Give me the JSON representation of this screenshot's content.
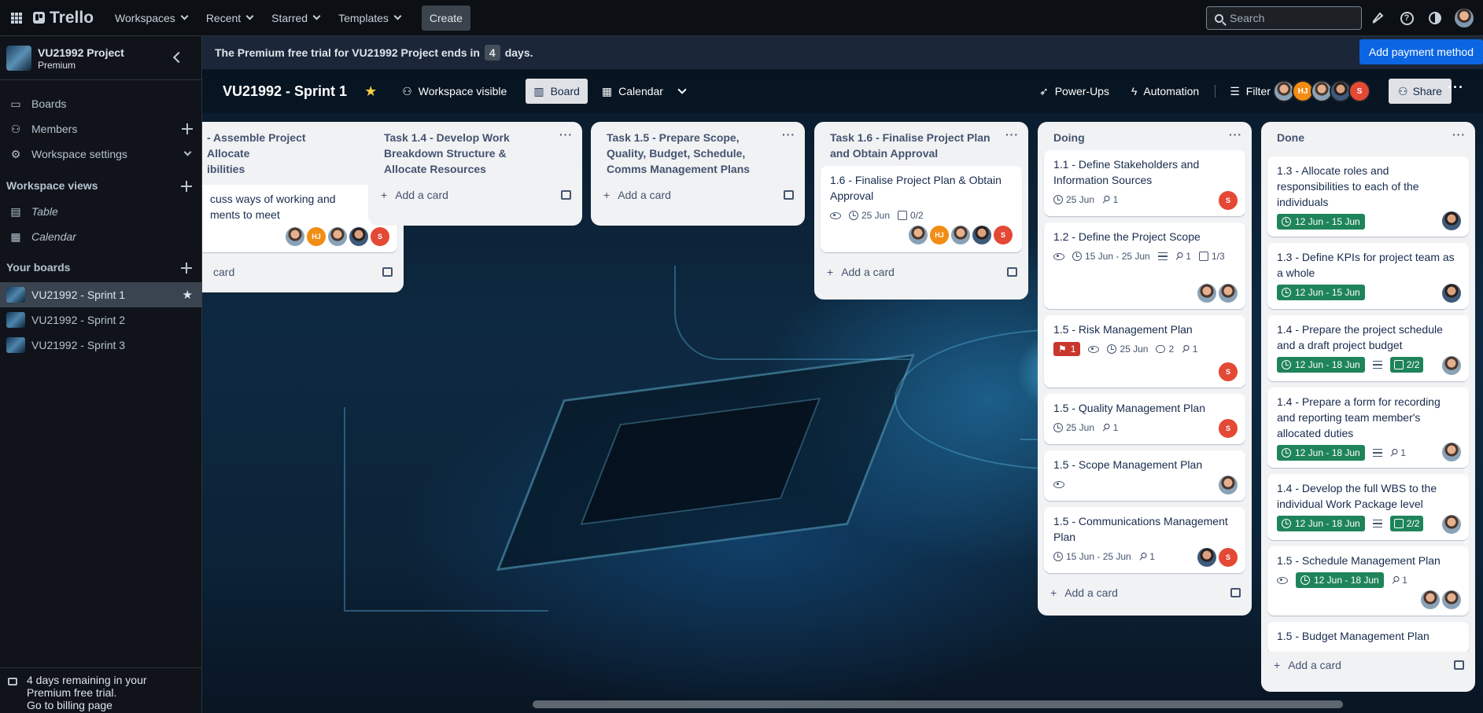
{
  "topnav": {
    "logo": "Trello",
    "menus": [
      "Workspaces",
      "Recent",
      "Starred",
      "Templates"
    ],
    "create": "Create",
    "search_placeholder": "Search"
  },
  "sidebar": {
    "workspace_name": "VU21992 Project",
    "workspace_plan": "Premium",
    "items": [
      "Boards",
      "Members",
      "Workspace settings"
    ],
    "views_heading": "Workspace views",
    "views": [
      "Table",
      "Calendar"
    ],
    "boards_heading": "Your boards",
    "boards": [
      "VU21992 - Sprint 1",
      "VU21992 - Sprint 2",
      "VU21992 - Sprint 3"
    ],
    "footer_line1": "4 days remaining in your",
    "footer_line2": "Premium free trial.",
    "footer_link": "Go to billing page"
  },
  "banner": {
    "text_before": "The Premium free trial for VU21992 Project ends in",
    "days": "4",
    "text_after": "days.",
    "button": "Add payment method"
  },
  "board": {
    "title": "VU21992 - Sprint 1",
    "visibility": "Workspace visible",
    "view_board": "Board",
    "view_calendar": "Calendar",
    "powerups": "Power-Ups",
    "automation": "Automation",
    "filter": "Filter",
    "member_initials": [
      "HJ",
      "S"
    ],
    "share": "Share"
  },
  "lists": {
    "add_card": "Add a card",
    "list1": {
      "title": "- Assemble Project\n Allocate\nibilities",
      "card1": "cuss ways of working and\nments to meet",
      "add_card": "card"
    },
    "list2": {
      "title": "Task 1.4 - Develop Work Breakdown Structure & Allocate Resources"
    },
    "list3": {
      "title": "Task 1.5 - Prepare Scope, Quality, Budget, Schedule, Comms Management Plans"
    },
    "list4": {
      "title": "Task 1.6 - Finalise Project Plan and Obtain Approval",
      "card1": {
        "title": "1.6 - Finalise Project Plan & Obtain Approval",
        "date": "25 Jun",
        "checklist": "0/2"
      }
    },
    "doing": {
      "title": "Doing",
      "cards": [
        {
          "title": "1.1 - Define Stakeholders and Information Sources",
          "date": "25 Jun",
          "attachments": "1"
        },
        {
          "title": "1.2 - Define the Project Scope",
          "date": "15 Jun - 25 Jun",
          "attachments": "1",
          "checklist": "1/3"
        },
        {
          "title": "1.5 - Risk Management Plan",
          "votes": "1",
          "date": "25 Jun",
          "comments": "2",
          "attachments": "1"
        },
        {
          "title": "1.5 - Quality Management Plan",
          "date": "25 Jun",
          "attachments": "1"
        },
        {
          "title": "1.5 - Scope Management Plan"
        },
        {
          "title": "1.5 - Communications Management Plan",
          "date": "15 Jun - 25 Jun",
          "attachments": "1"
        }
      ]
    },
    "done": {
      "title": "Done",
      "cards": [
        {
          "title": "1.3 - Allocate roles and responsibilities to each of the individuals",
          "date": "12 Jun - 15 Jun"
        },
        {
          "title": "1.3 - Define KPIs for project team as a whole",
          "date": "12 Jun - 15 Jun"
        },
        {
          "title": "1.4 - Prepare the project schedule and a draft project budget",
          "date": "12 Jun - 18 Jun",
          "checklist": "2/2"
        },
        {
          "title": "1.4 - Prepare a form for recording and reporting team member's allocated duties",
          "date": "12 Jun - 18 Jun",
          "attachments": "1"
        },
        {
          "title": "1.4 - Develop the full WBS to the individual Work Package level",
          "date": "12 Jun - 18 Jun",
          "checklist": "2/2"
        },
        {
          "title": "1.5 - Schedule Management Plan",
          "date": "12 Jun - 18 Jun",
          "attachments": "1"
        },
        {
          "title": "1.5 - Budget Management Plan"
        }
      ]
    }
  }
}
